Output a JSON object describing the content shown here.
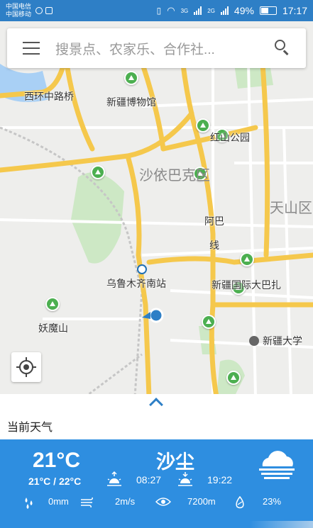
{
  "status_bar": {
    "carrier_1": "中国电信",
    "carrier_2": "中国移动",
    "battery": "49%",
    "time": "17:17",
    "network_1": "3G",
    "network_2": "2G"
  },
  "search": {
    "placeholder": "搜景点、农家乐、合作社..."
  },
  "map": {
    "labels": {
      "xihuan_bridge": "西环中路桥",
      "museum": "新疆博物馆",
      "park": "红山公园",
      "district_shayibake": "沙依巴克区",
      "district_tianshan": "天山区",
      "road_aba": "阿巴",
      "road_xian": "线",
      "station": "乌鲁木齐南站",
      "bazaar": "新疆国际大巴扎",
      "university": "新疆大学",
      "yaomoshan": "妖魔山"
    },
    "colors": {
      "road_major": "#f5c84c",
      "road_minor": "#ffffff",
      "green": "#cde8c5",
      "water": "#a9d0f5",
      "poi": "#4caf50"
    }
  },
  "sheet": {
    "title": "当前天气"
  },
  "weather": {
    "temperature": "21°C",
    "range": "21°C / 22°C",
    "condition": "沙尘",
    "sunrise": "08:27",
    "sunset": "19:22",
    "precipitation": "0mm",
    "wind": "2m/s",
    "visibility": "7200m",
    "humidity": "23%",
    "accent": "#2e8ee0"
  }
}
